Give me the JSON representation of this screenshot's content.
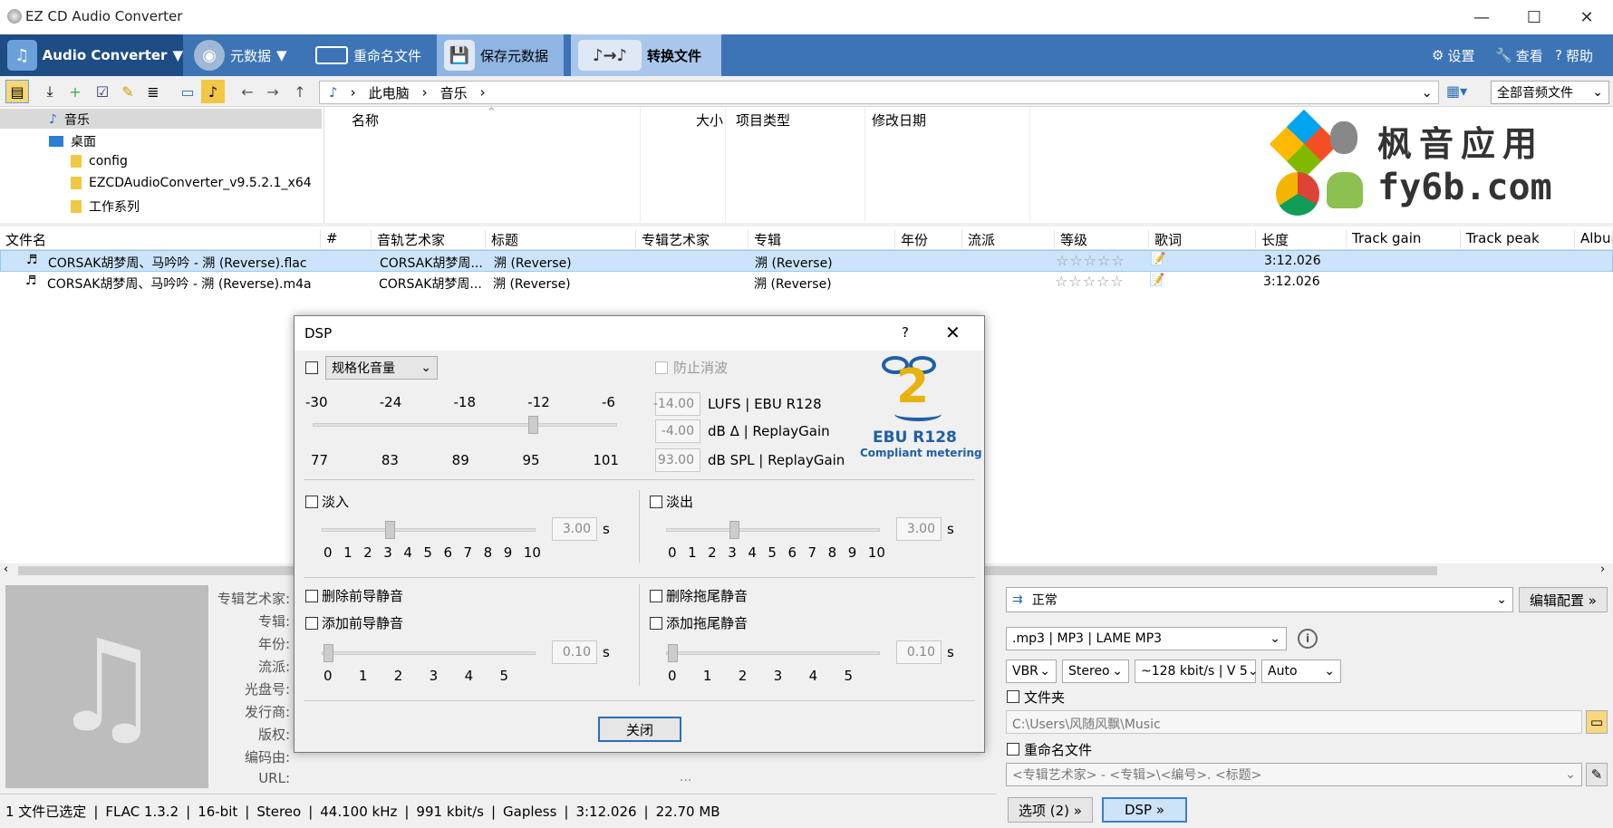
{
  "window": {
    "title": "EZ CD Audio Converter"
  },
  "ribbon": {
    "app_label": "Audio Converter",
    "metadata": "元数据",
    "rename": "重命名文件",
    "save_meta": "保存元数据",
    "convert": "转换文件",
    "settings": "设置",
    "view": "查看",
    "help": "帮助"
  },
  "toolbar": {
    "crumbs": [
      "此电脑",
      "音乐"
    ],
    "filter": "全部音频文件"
  },
  "tree": {
    "items": [
      "音乐",
      "桌面",
      "config",
      "EZCDAudioConverter_v9.5.2.1_x64",
      "工作系列"
    ]
  },
  "browser": {
    "columns": [
      "名称",
      "大小",
      "项目类型",
      "修改日期"
    ]
  },
  "watermark": {
    "line1": "枫音应用",
    "line2": "fy6b.com"
  },
  "filelist": {
    "columns": [
      "文件名",
      "#",
      "音轨艺术家",
      "标题",
      "专辑艺术家",
      "专辑",
      "年份",
      "流派",
      "等级",
      "歌词",
      "长度",
      "Track gain",
      "Track peak",
      "Album"
    ],
    "rows": [
      {
        "name": "CORSAK胡梦周、马吟吟 - 溯 (Reverse).flac",
        "artist": "CORSAK胡梦周...",
        "title": "溯 (Reverse)",
        "album": "溯 (Reverse)",
        "rating": "☆☆☆☆☆",
        "length": "3:12.026"
      },
      {
        "name": "CORSAK胡梦周、马吟吟 - 溯 (Reverse).m4a",
        "artist": "CORSAK胡梦周...",
        "title": "溯 (Reverse)",
        "album": "溯 (Reverse)",
        "rating": "☆☆☆☆☆",
        "length": "3:12.026"
      }
    ]
  },
  "meta_labels": [
    "专辑艺术家:",
    "专辑:",
    "年份:",
    "流派:",
    "光盘号:",
    "发行商:",
    "版权:",
    "编码由:",
    "URL:"
  ],
  "ellipsis": "...",
  "status": {
    "items": [
      "1 文件已选定",
      "FLAC 1.3.2",
      "16-bit",
      "Stereo",
      "44.100 kHz",
      "991 kbit/s",
      "Gapless",
      "3:12.026",
      "22.70 MB"
    ],
    "sep": "|"
  },
  "output": {
    "profile": "正常",
    "edit_profile": "编辑配置 »",
    "format": ".mp3 | MP3 | LAME MP3",
    "mode": "VBR",
    "channels": "Stereo",
    "bitrate": "~128 kbit/s | V 5",
    "quality": "Auto",
    "folder_label": "文件夹",
    "folder_path": "C:\\Users\\风随风飘\\Music",
    "rename_label": "重命名文件",
    "rename_pattern": "<专辑艺术家> - <专辑>\\<编号>. <标题>",
    "options_btn": "选项 (2) »",
    "dsp_btn": "DSP »"
  },
  "dsp": {
    "title": "DSP",
    "help": "?",
    "normalize": "规格化音量",
    "anticlip": "防止消波",
    "scale_top": [
      "-30",
      "-24",
      "-18",
      "-12",
      "-6"
    ],
    "scale_bottom": [
      "77",
      "83",
      "89",
      "95",
      "101"
    ],
    "lufs_val": "-14.00",
    "lufs_label": "LUFS | EBU R128",
    "db_val": "-4.00",
    "db_label": "dB Δ | ReplayGain",
    "spl_val": "93.00",
    "spl_label": "dB SPL | ReplayGain",
    "logo_text": "EBU R128",
    "logo_sub": "Compliant metering",
    "logo_num": "2",
    "fadein": "淡入",
    "fadeout": "淡出",
    "fade_val": "3.00",
    "unit": "s",
    "fade_ticks": [
      "0",
      "1",
      "2",
      "3",
      "4",
      "5",
      "6",
      "7",
      "8",
      "9",
      "10"
    ],
    "del_lead": "删除前导静音",
    "del_trail": "删除拖尾静音",
    "add_lead": "添加前导静音",
    "add_trail": "添加拖尾静音",
    "sil_val": "0.10",
    "sil_ticks": [
      "0",
      "1",
      "2",
      "3",
      "4",
      "5"
    ],
    "close": "关闭"
  },
  "colors": {
    "ribbon": "#3d74b5",
    "ribbon_active": "#1e4c84",
    "selection": "#cce4fb",
    "ebu_blue": "#1f5fa6",
    "ebu_gold": "#e8b20f"
  }
}
